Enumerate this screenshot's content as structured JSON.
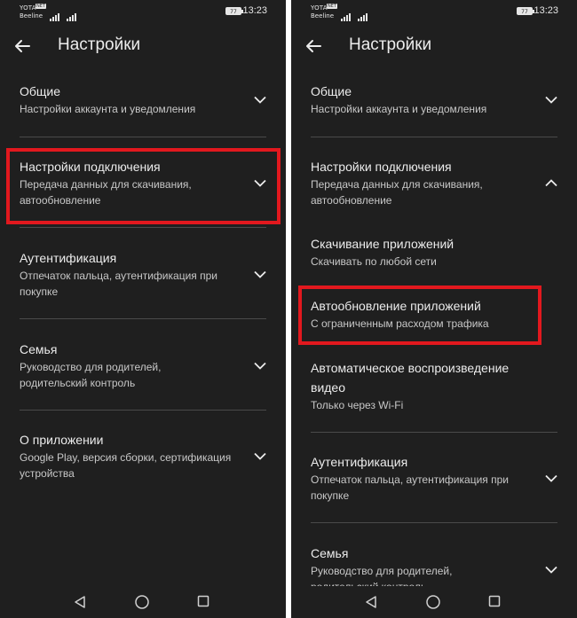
{
  "status_bar": {
    "carrier_1": "YOTA",
    "carrier_2": "Beeline",
    "network_badge": "NET",
    "battery_level": "77",
    "time": "13:23"
  },
  "left": {
    "title": "Настройки",
    "items": [
      {
        "title": "Общие",
        "subtitle": "Настройки аккаунта и уведомления"
      },
      {
        "title": "Настройки подключения",
        "subtitle_1": "Передача данных для скачивания,",
        "subtitle_2": "автообновление"
      },
      {
        "title": "Аутентификация",
        "subtitle_1": "Отпечаток пальца, аутентификация при",
        "subtitle_2": "покупке"
      },
      {
        "title": "Семья",
        "subtitle_1": "Руководство для родителей,",
        "subtitle_2": "родительский контроль"
      },
      {
        "title": "О приложении",
        "subtitle_1": "Google Play, версия сборки, сертификация",
        "subtitle_2": "устройства"
      }
    ]
  },
  "right": {
    "title": "Настройки",
    "items": [
      {
        "title": "Общие",
        "subtitle": "Настройки аккаунта и уведомления"
      },
      {
        "title": "Настройки подключения",
        "subtitle_1": "Передача данных для скачивания,",
        "subtitle_2": "автообновление"
      },
      {
        "title": "Скачивание приложений",
        "subtitle": "Скачивать по любой сети"
      },
      {
        "title": "Автообновление приложений",
        "subtitle": "С ограниченным расходом трафика"
      },
      {
        "title_1": "Автоматическое воспроизведение",
        "title_2": "видео",
        "subtitle": "Только через Wi-Fi"
      },
      {
        "title": "Аутентификация",
        "subtitle_1": "Отпечаток пальца, аутентификация при",
        "subtitle_2": "покупке"
      },
      {
        "title": "Семья",
        "subtitle_1": "Руководство для родителей,",
        "subtitle_2": "родительский контроль"
      }
    ]
  },
  "colors": {
    "background": "#1f1f1f",
    "highlight": "#e2181e",
    "text_primary": "#ececec",
    "text_secondary": "#c8c8c8",
    "divider": "#4a4a4a"
  }
}
